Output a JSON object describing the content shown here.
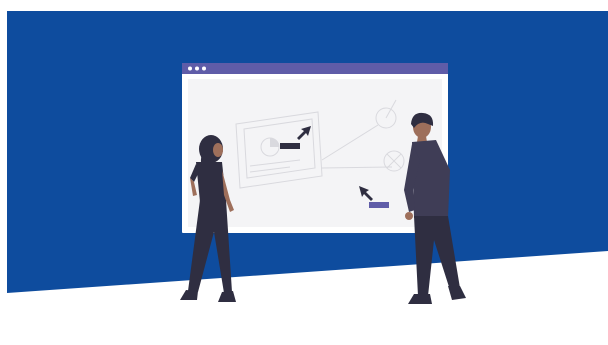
{
  "colors": {
    "background_blue": "#0E4C9E",
    "page_white": "#FFFFFF",
    "window_chrome": "#5F5CA8",
    "window_dots": "#FFFFFF",
    "window_canvas": "#F4F4F6",
    "sketch_lines": "#D9D9DE",
    "cursor_dark": "#2F2E41",
    "label_bar_dark": "#2F2E41",
    "label_bar_accent": "#5F5CA8",
    "skin": "#9E6F5B",
    "hair_dark": "#2F2E41",
    "clothing_dark": "#2F2E41",
    "clothing_shirt_man": "#3F3D56",
    "shoes": "#2F2E41"
  },
  "illustration": {
    "subject": "two-people-viewing-browser-wireframe",
    "icons": [
      "browser-window-icon",
      "cursor-icon",
      "target-icon"
    ]
  }
}
